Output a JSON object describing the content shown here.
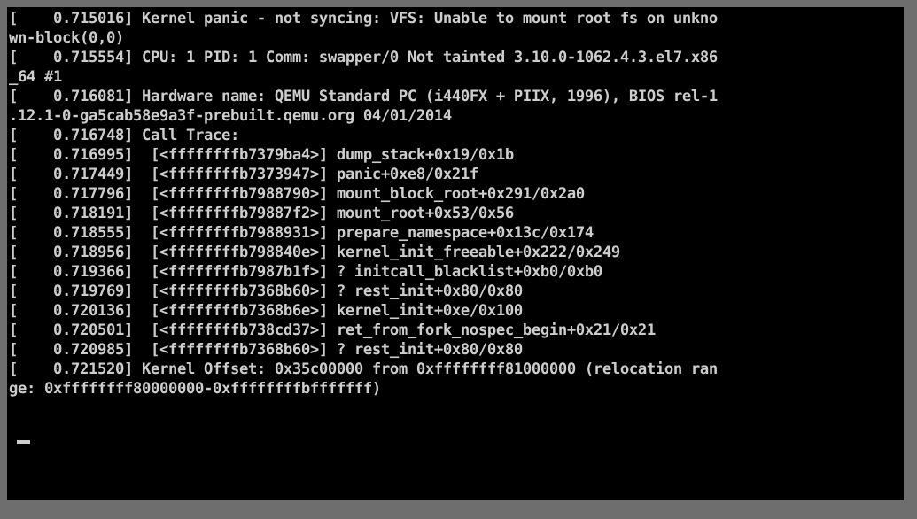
{
  "terminal": {
    "background_color": "#000000",
    "text_color": "#cdcdcd",
    "frame_color": "#6e6e6e",
    "cursor_glyph": "_",
    "lines": [
      "[    0.715016] Kernel panic - not syncing: VFS: Unable to mount root fs on unkno",
      "wn-block(0,0)",
      "[    0.715554] CPU: 1 PID: 1 Comm: swapper/0 Not tainted 3.10.0-1062.4.3.el7.x86",
      "_64 #1",
      "[    0.716081] Hardware name: QEMU Standard PC (i440FX + PIIX, 1996), BIOS rel-1",
      ".12.1-0-ga5cab58e9a3f-prebuilt.qemu.org 04/01/2014",
      "[    0.716748] Call Trace:",
      "[    0.716995]  [<ffffffffb7379ba4>] dump_stack+0x19/0x1b",
      "[    0.717449]  [<ffffffffb7373947>] panic+0xe8/0x21f",
      "[    0.717796]  [<ffffffffb7988790>] mount_block_root+0x291/0x2a0",
      "[    0.718191]  [<ffffffffb79887f2>] mount_root+0x53/0x56",
      "[    0.718555]  [<ffffffffb7988931>] prepare_namespace+0x13c/0x174",
      "[    0.718956]  [<ffffffffb798840e>] kernel_init_freeable+0x222/0x249",
      "[    0.719366]  [<ffffffffb7987b1f>] ? initcall_blacklist+0xb0/0xb0",
      "[    0.719769]  [<ffffffffb7368b60>] ? rest_init+0x80/0x80",
      "[    0.720136]  [<ffffffffb7368b6e>] kernel_init+0xe/0x100",
      "[    0.720501]  [<ffffffffb738cd37>] ret_from_fork_nospec_begin+0x21/0x21",
      "[    0.720985]  [<ffffffffb7368b60>] ? rest_init+0x80/0x80",
      "[    0.721520] Kernel Offset: 0x35c00000 from 0xffffffff81000000 (relocation ran",
      "ge: 0xffffffff80000000-0xffffffffbfffffff)"
    ],
    "messages": {
      "panic": "Kernel panic - not syncing: VFS: Unable to mount root fs on unknown-block(0,0)",
      "cpu": "CPU: 1 PID: 1 Comm: swapper/0 Not tainted 3.10.0-1062.4.3.el7.x86_64 #1",
      "hardware": "Hardware name: QEMU Standard PC (i440FX + PIIX, 1996), BIOS rel-1.12.1-0-ga5cab58e9a3f-prebuilt.qemu.org 04/01/2014",
      "call_trace_header": "Call Trace:",
      "kernel_offset": "Kernel Offset: 0x35c00000 from 0xffffffff81000000 (relocation range: 0xffffffff80000000-0xffffffffbfffffff)"
    },
    "kernel_version": "3.10.0-1062.4.3.el7.x86_64",
    "timestamps": [
      "0.715016",
      "0.715554",
      "0.716081",
      "0.716748",
      "0.716995",
      "0.717449",
      "0.717796",
      "0.718191",
      "0.718555",
      "0.718956",
      "0.719366",
      "0.719769",
      "0.720136",
      "0.720501",
      "0.720985",
      "0.721520"
    ],
    "call_trace": [
      {
        "timestamp": "0.716995",
        "address": "ffffffffb7379ba4",
        "symbol": "dump_stack+0x19/0x1b",
        "speculative": false
      },
      {
        "timestamp": "0.717449",
        "address": "ffffffffb7373947",
        "symbol": "panic+0xe8/0x21f",
        "speculative": false
      },
      {
        "timestamp": "0.717796",
        "address": "ffffffffb7988790",
        "symbol": "mount_block_root+0x291/0x2a0",
        "speculative": false
      },
      {
        "timestamp": "0.718191",
        "address": "ffffffffb79887f2",
        "symbol": "mount_root+0x53/0x56",
        "speculative": false
      },
      {
        "timestamp": "0.718555",
        "address": "ffffffffb7988931",
        "symbol": "prepare_namespace+0x13c/0x174",
        "speculative": false
      },
      {
        "timestamp": "0.718956",
        "address": "ffffffffb798840e",
        "symbol": "kernel_init_freeable+0x222/0x249",
        "speculative": false
      },
      {
        "timestamp": "0.719366",
        "address": "ffffffffb7987b1f",
        "symbol": "initcall_blacklist+0xb0/0xb0",
        "speculative": true
      },
      {
        "timestamp": "0.719769",
        "address": "ffffffffb7368b60",
        "symbol": "rest_init+0x80/0x80",
        "speculative": true
      },
      {
        "timestamp": "0.720136",
        "address": "ffffffffb7368b6e",
        "symbol": "kernel_init+0xe/0x100",
        "speculative": false
      },
      {
        "timestamp": "0.720501",
        "address": "ffffffffb738cd37",
        "symbol": "ret_from_fork_nospec_begin+0x21/0x21",
        "speculative": false
      },
      {
        "timestamp": "0.720985",
        "address": "ffffffffb7368b60",
        "symbol": "rest_init+0x80/0x80",
        "speculative": true
      }
    ]
  }
}
